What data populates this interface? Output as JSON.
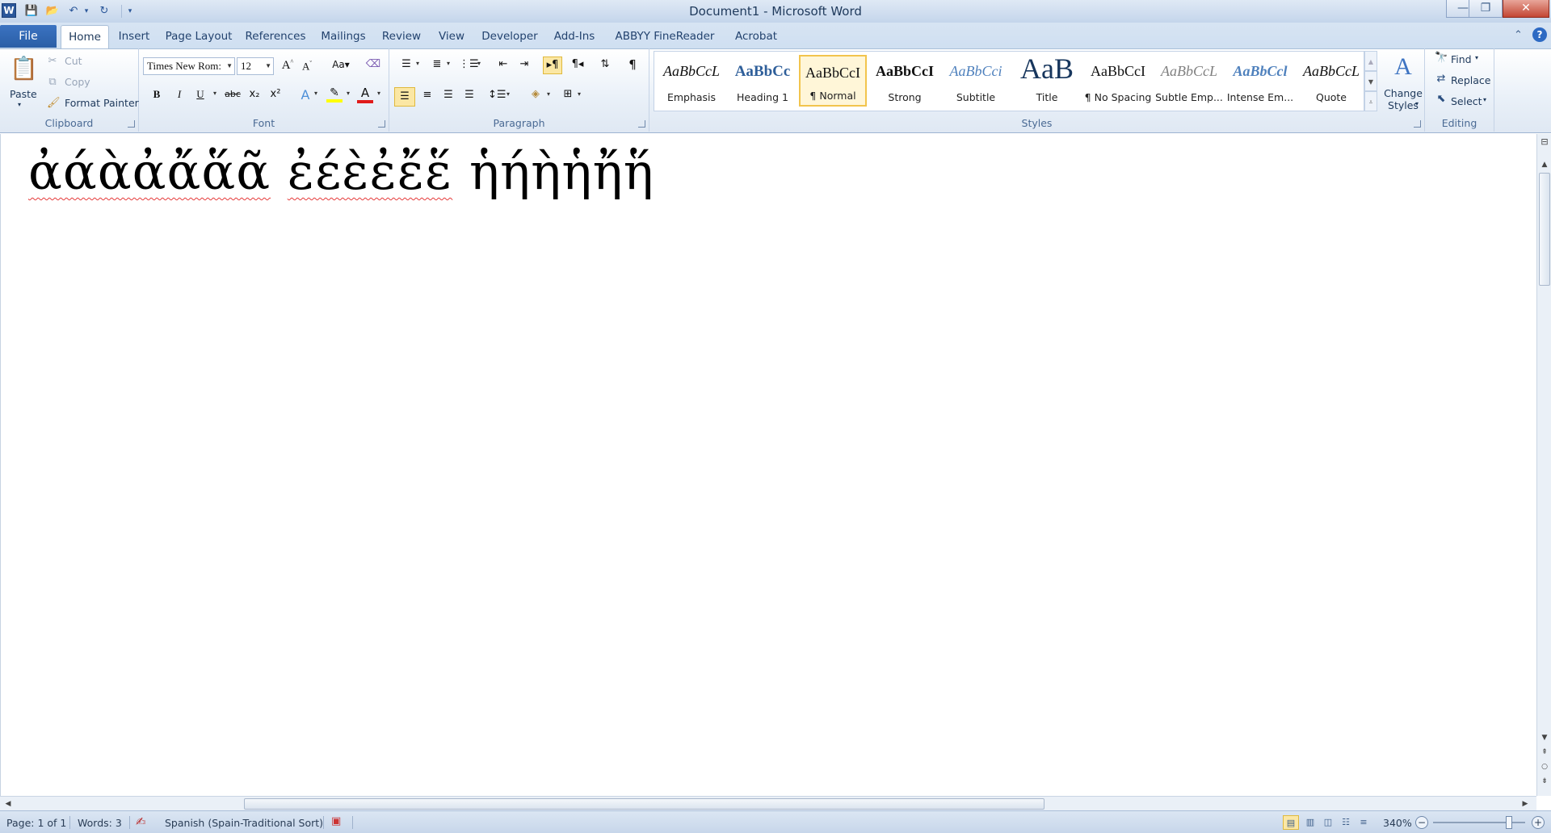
{
  "window": {
    "title": "Document1 - Microsoft Word",
    "app_icon_letter": "W",
    "controls": [
      "minimize-icon",
      "restore-icon",
      "close-icon"
    ]
  },
  "quick_access": [
    "save-icon",
    "open-icon",
    "undo-icon",
    "redo-icon",
    "customize-icon"
  ],
  "tabs": {
    "file": "File",
    "items": [
      "Home",
      "Insert",
      "Page Layout",
      "References",
      "Mailings",
      "Review",
      "View",
      "Developer",
      "Add-Ins",
      "ABBYY FineReader 11",
      "Acrobat"
    ],
    "active": "Home"
  },
  "clipboard": {
    "paste": "Paste",
    "cut": "Cut",
    "copy": "Copy",
    "format_painter": "Format Painter",
    "label": "Clipboard"
  },
  "font": {
    "name": "Times New Roman",
    "name_display": "Times New Rom:",
    "size": "12",
    "label": "Font",
    "buttons": [
      "B",
      "I",
      "U",
      "abc",
      "x₂",
      "x²"
    ]
  },
  "paragraph": {
    "label": "Paragraph"
  },
  "styles": {
    "label": "Styles",
    "items": [
      {
        "preview": "AaBbCcL",
        "name": "Emphasis"
      },
      {
        "preview": "AaBbCc",
        "name": "Heading 1"
      },
      {
        "preview": "AaBbCcI",
        "name": "¶ Normal"
      },
      {
        "preview": "AaBbCcI",
        "name": "Strong"
      },
      {
        "preview": "AaBbCci",
        "name": "Subtitle"
      },
      {
        "preview": "AaB",
        "name": "Title"
      },
      {
        "preview": "AaBbCcI",
        "name": "¶ No Spacing"
      },
      {
        "preview": "AaBbCcL",
        "name": "Subtle Emp..."
      },
      {
        "preview": "AaBbCcl",
        "name": "Intense Em..."
      },
      {
        "preview": "AaBbCcL",
        "name": "Quote"
      }
    ],
    "selected": "¶ Normal",
    "change_styles": "Change Styles"
  },
  "editing": {
    "label": "Editing",
    "find": "Find",
    "replace": "Replace",
    "select": "Select"
  },
  "document": {
    "word1": "ἀάὰἀἄἅᾶ",
    "word2": "ἐέὲἐἔἕ",
    "word3": "ἡήὴἡἤἥ"
  },
  "statusbar": {
    "page": "Page: 1 of 1",
    "words": "Words: 3",
    "language": "Spanish (Spain-Traditional Sort)",
    "zoom": "340%"
  },
  "colors": {
    "ribbon_accent": "#2b579a",
    "file_tab": "#2a5ea6",
    "selected_style": "#f2c44d",
    "spelling_underline": "#e53a3a"
  }
}
